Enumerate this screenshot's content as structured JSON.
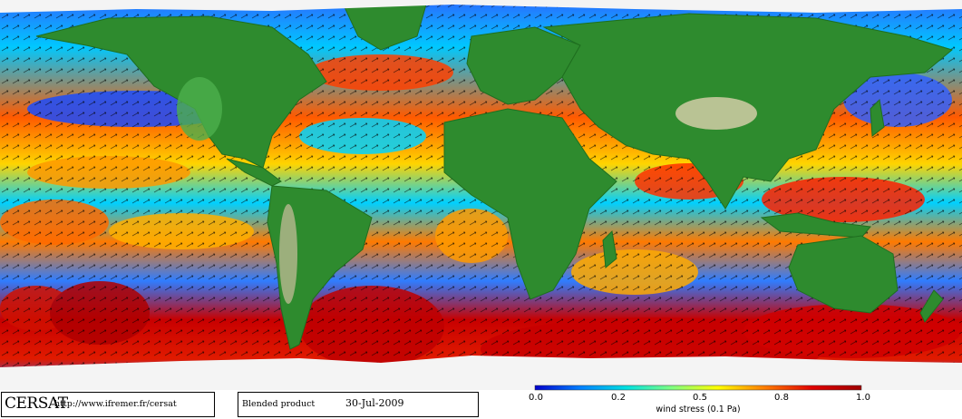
{
  "footer": {
    "brand": "CERSAT",
    "url": "http://www.ifremer.fr/cersat",
    "product": "Blended product",
    "date": "30-Jul-2009"
  },
  "colorbar": {
    "ticks": [
      "0.0",
      "0.2",
      "0.5",
      "0.8",
      "1.0"
    ],
    "label": "wind stress (0.1 Pa)",
    "colors": [
      "#0000cc",
      "#0080ff",
      "#00e0e0",
      "#80ff80",
      "#ffff00",
      "#ff8000",
      "#e00000",
      "#a00000"
    ]
  },
  "colors": {
    "land": "#2e8b2e",
    "land_light": "#4caf4c",
    "ice": "#f4f4f4",
    "desert": "#c9c9a0"
  }
}
